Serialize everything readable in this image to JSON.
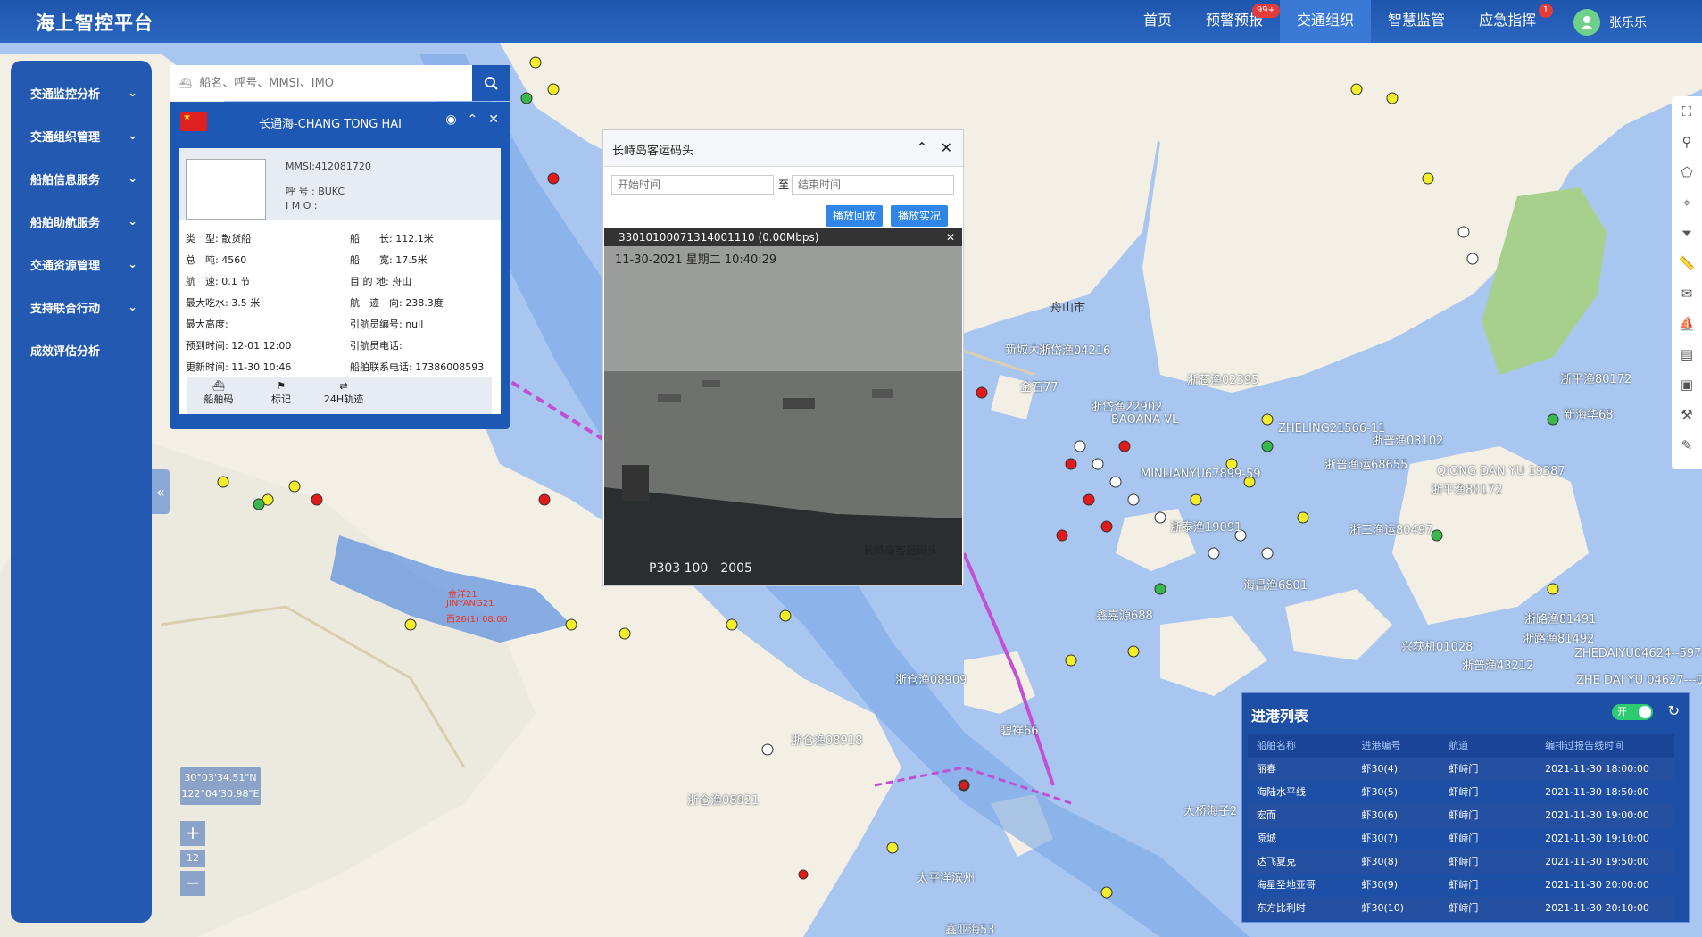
{
  "app": {
    "title": "海上智控平台"
  },
  "nav": [
    {
      "label": "首页"
    },
    {
      "label": "预警预报",
      "badge": "99+"
    },
    {
      "label": "交通组织",
      "active": true
    },
    {
      "label": "智慧监管"
    },
    {
      "label": "应急指挥",
      "badge": "1"
    }
  ],
  "user": {
    "name": "张乐乐"
  },
  "sidebar": [
    {
      "label": "交通监控分析",
      "arrow": true
    },
    {
      "label": "交通组织管理",
      "arrow": true
    },
    {
      "label": "船舶信息服务",
      "arrow": true
    },
    {
      "label": "船舶助航服务",
      "arrow": true
    },
    {
      "label": "交通资源管理",
      "arrow": true
    },
    {
      "label": "支持联合行动",
      "arrow": true
    },
    {
      "label": "成效评估分析",
      "arrow": false
    }
  ],
  "search": {
    "placeholder": "船名、呼号、MMSI、IMO"
  },
  "ship": {
    "title": "长通海-CHANG TONG HAI",
    "mmsi": "MMSI:412081720",
    "callsign": "呼 号 : BUKC",
    "imo": "I M O :",
    "fields": [
      {
        "l": "类　型: 散货船",
        "r": "船　　长: 112.1米"
      },
      {
        "l": "总　吨: 4560",
        "r": "船　　宽: 17.5米"
      },
      {
        "l": "航　速: 0.1 节",
        "r": "目 的 地: 舟山"
      },
      {
        "l": "最大吃水: 3.5 米",
        "r": "航　迹　向: 238.3度"
      },
      {
        "l": "最大高度:",
        "r": "引航员编号: null"
      },
      {
        "l": "预到时间: 12-01 12:00",
        "r": "引航员电话:"
      },
      {
        "l": "更新时间: 11-30 10:46",
        "r": "船舶联系电话: 17386008593"
      }
    ],
    "actions": [
      {
        "label": "船舶码",
        "icon": "ship-code-icon"
      },
      {
        "label": "标记",
        "icon": "flag-icon"
      },
      {
        "label": "24H轨迹",
        "icon": "track-icon"
      }
    ]
  },
  "video": {
    "title": "长峙岛客运码头",
    "start_placeholder": "开始时间",
    "to": "至",
    "end_placeholder": "结束时间",
    "replay": "播放回放",
    "live": "播放实况",
    "stream": "33010100071314001110  (0.00Mbps)",
    "osd_time": "11-30-2021 星期二 10:40:29",
    "osd_cam": "P303 100　2005",
    "osd_text": "长峙岛客运码头"
  },
  "harbor": {
    "title": "进港列表",
    "toggle": "开",
    "headers": [
      "船舶名称",
      "进港编号",
      "航道",
      "编排过报告线时间"
    ],
    "rows": [
      [
        "丽春",
        "虾30(4)",
        "虾峙门",
        "2021-11-30 18:00:00"
      ],
      [
        "海陆水平线",
        "虾30(5)",
        "虾峙门",
        "2021-11-30 18:50:00"
      ],
      [
        "宏而",
        "虾30(6)",
        "虾峙门",
        "2021-11-30 19:00:00"
      ],
      [
        "原城",
        "虾30(7)",
        "虾峙门",
        "2021-11-30 19:10:00"
      ],
      [
        "达飞夏克",
        "虾30(8)",
        "虾峙门",
        "2021-11-30 19:50:00"
      ],
      [
        "海星圣地亚哥",
        "虾30(9)",
        "虾峙门",
        "2021-11-30 20:00:00"
      ],
      [
        "东方比利时",
        "虾30(10)",
        "虾峙门",
        "2021-11-30 20:10:00"
      ]
    ]
  },
  "map": {
    "coord_lat": "30°03'34.51\"N",
    "coord_lon": "122°04'30.98\"E",
    "zoom_level": "12",
    "labels": [
      "新城大桥",
      "金石77",
      "浙岱渔22902",
      "BAOANA VL",
      "浙苍渔02395",
      "ZHELING21566-11",
      "浙普渔03102",
      "QIONG DAN YU 19387",
      "浙平渔80172",
      "新海华68",
      "浙岱渔04216",
      "MINLIANYU67899-59",
      "海昌渔6801",
      "鑫嘉源688",
      "浙路渔81491",
      "浙路渔81492",
      "ZHEDAIYU04624--597",
      "ZHE DAI YU 04627---0",
      "兴获机01028",
      "浙普渔43212",
      "浙仓渔08909",
      "浙仓渔08918",
      "浙仓渔08921",
      "碧祥66",
      "太平洋滨州",
      "鑫亚海53",
      "舟山市",
      "大桥海子2",
      "浙三渔运80497",
      "浙普渔运68655",
      "浙泰渔19091",
      "浙平渔80172",
      "金洋21",
      "JINYANG21",
      "西26(1) 08:00"
    ]
  }
}
